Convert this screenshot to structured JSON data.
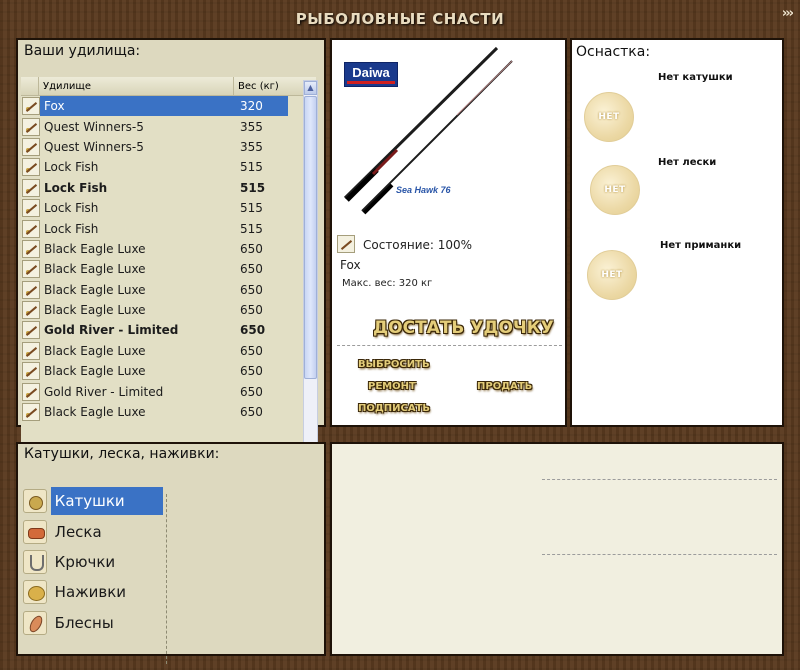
{
  "header": {
    "title": "РЫБОЛОВНЫЕ СНАСТИ",
    "arrow": "›››"
  },
  "rods_panel": {
    "title": "Ваши удилища:",
    "columns": {
      "name": "Удилище",
      "weight": "Вес (кг)"
    },
    "rows": [
      {
        "name": "Fox",
        "weight": "320",
        "selected": true,
        "bold": false
      },
      {
        "name": "Quest Winners-5",
        "weight": "355",
        "selected": false,
        "bold": false
      },
      {
        "name": "Quest Winners-5",
        "weight": "355",
        "selected": false,
        "bold": false
      },
      {
        "name": "Lock Fish",
        "weight": "515",
        "selected": false,
        "bold": false
      },
      {
        "name": "Lock Fish",
        "weight": "515",
        "selected": false,
        "bold": true
      },
      {
        "name": "Lock Fish",
        "weight": "515",
        "selected": false,
        "bold": false
      },
      {
        "name": "Lock Fish",
        "weight": "515",
        "selected": false,
        "bold": false
      },
      {
        "name": "Black Eagle Luxe",
        "weight": "650",
        "selected": false,
        "bold": false
      },
      {
        "name": "Black Eagle Luxe",
        "weight": "650",
        "selected": false,
        "bold": false
      },
      {
        "name": "Black Eagle Luxe",
        "weight": "650",
        "selected": false,
        "bold": false
      },
      {
        "name": "Black Eagle Luxe",
        "weight": "650",
        "selected": false,
        "bold": false
      },
      {
        "name": "Gold River - Limited",
        "weight": "650",
        "selected": false,
        "bold": true
      },
      {
        "name": "Black Eagle Luxe",
        "weight": "650",
        "selected": false,
        "bold": false
      },
      {
        "name": "Black Eagle Luxe",
        "weight": "650",
        "selected": false,
        "bold": false
      },
      {
        "name": "Gold River - Limited",
        "weight": "650",
        "selected": false,
        "bold": false
      },
      {
        "name": "Black Eagle Luxe",
        "weight": "650",
        "selected": false,
        "bold": false
      }
    ]
  },
  "rod_detail": {
    "brand": "Daiwa",
    "model": "Sea Hawk 76",
    "state_label": "Состояние: 100%",
    "rod_name": "Fox",
    "max_weight_label": "Макс. вес: 320 кг",
    "get_button": "ДОСТАТЬ УДОЧКУ",
    "throw_button": "ВЫБРОСИТЬ",
    "repair_button": "РЕМОНТ",
    "sell_button": "ПРОДАТЬ",
    "sign_button": "ПОДПИСАТЬ"
  },
  "tackle_panel": {
    "title": "Оснастка:",
    "empty_mark": "НЕТ",
    "slots": [
      {
        "label": "Нет катушки",
        "icon": "reel-icon"
      },
      {
        "label": "Нет лески",
        "icon": "line-spool-icon"
      },
      {
        "label": "Нет приманки",
        "icon": "lure-icon"
      }
    ]
  },
  "categories_panel": {
    "title": "Катушки, леска, наживки:",
    "items": [
      {
        "label": "Катушки",
        "active": true
      },
      {
        "label": "Леска",
        "active": false
      },
      {
        "label": "Крючки",
        "active": false
      },
      {
        "label": "Наживки",
        "active": false
      },
      {
        "label": "Блесны",
        "active": false
      }
    ]
  }
}
